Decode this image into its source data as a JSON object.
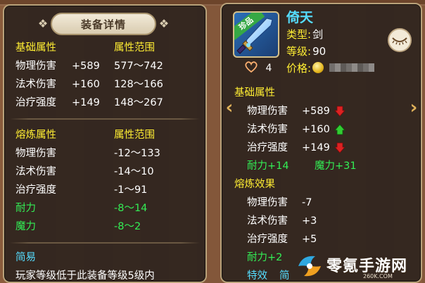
{
  "left_panel": {
    "title": "装备详情",
    "basic_header": "基础属性",
    "range_header": "属性范围",
    "basic_stats": [
      {
        "name": "物理伤害",
        "value": "+589",
        "range": "577～742"
      },
      {
        "name": "法术伤害",
        "value": "+160",
        "range": "128～166"
      },
      {
        "name": "治疗强度",
        "value": "+149",
        "range": "148～267"
      }
    ],
    "refine_header": "熔炼属性",
    "refine_range_header": "属性范围",
    "refine_stats": [
      {
        "name": "物理伤害",
        "range": "-12～133",
        "color": "white"
      },
      {
        "name": "法术伤害",
        "range": "-14～10",
        "color": "white"
      },
      {
        "name": "治疗强度",
        "range": "-1～91",
        "color": "white"
      },
      {
        "name": "耐力",
        "range": "-8～14",
        "color": "green"
      },
      {
        "name": "魔力",
        "range": "-8～2",
        "color": "green"
      }
    ],
    "desc_header": "简易",
    "desc_text": "玩家等级低于此装备等级5级内"
  },
  "right_panel": {
    "item_tag": "珍品",
    "item_name": "倚天",
    "type_label": "类型:",
    "type_value": "剑",
    "level_label": "等级:",
    "level_value": "90",
    "price_label": "价格:",
    "likes": "4",
    "basic_header": "基础属性",
    "basic_stats": [
      {
        "name": "物理伤害",
        "value": "+589",
        "trend": "down"
      },
      {
        "name": "法术伤害",
        "value": "+160",
        "trend": "up"
      },
      {
        "name": "治疗强度",
        "value": "+149",
        "trend": "down"
      }
    ],
    "extra_stat_1": "耐力+14",
    "extra_stat_2": "魔力+31",
    "refine_header": "熔炼效果",
    "refine_stats": [
      {
        "name": "物理伤害",
        "value": "-7"
      },
      {
        "name": "法术伤害",
        "value": "+3"
      },
      {
        "name": "治疗强度",
        "value": "+5"
      }
    ],
    "refine_extra": "耐力+2",
    "special_label": "特效",
    "special_value": "简"
  },
  "colors": {
    "panel_bg": "#28201c",
    "stat_yellow": "#ffee33",
    "stat_green": "#33ee55",
    "name_cyan": "#55ddff",
    "trend_up": "#33cc33",
    "trend_down": "#dd2222"
  },
  "icons": {
    "eye": "eye-icon",
    "heart": "heart-icon",
    "coin": "coin-icon",
    "prev": "chevron-left-icon",
    "next": "chevron-right-icon"
  },
  "watermark": {
    "title": "零氪手游网",
    "url": "260K.COM"
  }
}
